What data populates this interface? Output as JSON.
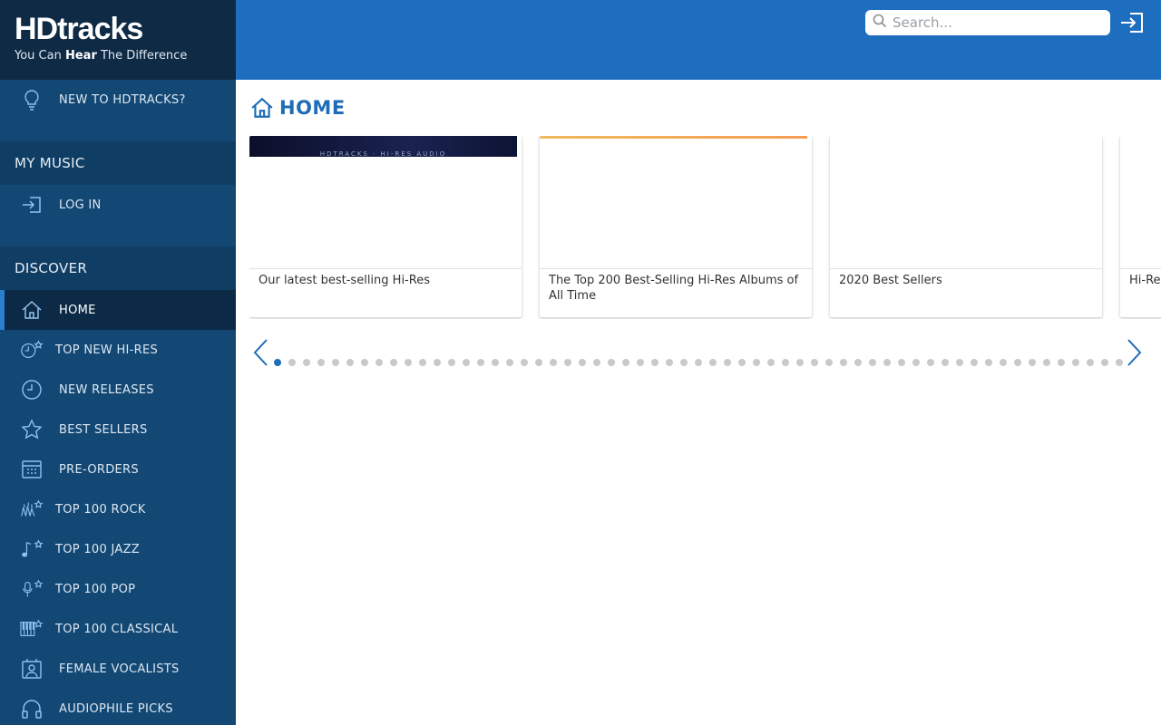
{
  "brand": {
    "logo": "HDtracks",
    "tagline_pre": "You Can ",
    "tagline_bold": "Hear",
    "tagline_post": " The Difference"
  },
  "sidebar": {
    "intro_item": {
      "label": "NEW TO HDTRACKS?",
      "icon": "lightbulb-icon"
    },
    "my_music": {
      "heading": "MY MUSIC",
      "items": [
        {
          "label": "LOG IN",
          "icon": "login-icon"
        }
      ]
    },
    "discover": {
      "heading": "DISCOVER",
      "items": [
        {
          "label": "HOME",
          "icon": "home-icon",
          "active": true
        },
        {
          "label": "TOP NEW HI-RES",
          "icon": "clock-star-icon"
        },
        {
          "label": "NEW RELEASES",
          "icon": "clock-icon"
        },
        {
          "label": "BEST SELLERS",
          "icon": "star-icon"
        },
        {
          "label": "PRE-ORDERS",
          "icon": "calendar-icon"
        },
        {
          "label": "TOP 100 ROCK",
          "icon": "rock-star-icon"
        },
        {
          "label": "TOP 100 JAZZ",
          "icon": "music-note-star-icon"
        },
        {
          "label": "TOP 100 POP",
          "icon": "microphone-star-icon"
        },
        {
          "label": "TOP 100 CLASSICAL",
          "icon": "piano-star-icon"
        },
        {
          "label": "FEMALE VOCALISTS",
          "icon": "female-vocalist-icon"
        },
        {
          "label": "AUDIOPHILE PICKS",
          "icon": "headphones-icon"
        }
      ]
    }
  },
  "topbar": {
    "search_placeholder": "Search...",
    "login_icon": "login-icon"
  },
  "main": {
    "title": "HOME",
    "title_icon": "home-icon",
    "cards": [
      {
        "caption": "Our latest best-selling Hi-Res",
        "banner_text": "HDTRACKS · HI-RES AUDIO"
      },
      {
        "caption": "The Top 200 Best-Selling Hi-Res Albums of All Time"
      },
      {
        "caption": "2020 Best Sellers"
      },
      {
        "caption": "Hi-Res"
      }
    ],
    "carousel_dot_count": 59,
    "carousel_active_index": 0
  },
  "colors": {
    "topbar": "#1e6ebf",
    "sidebar": "#134874",
    "sidebar_dark": "#0f2a45",
    "accent": "#1f6db6"
  }
}
